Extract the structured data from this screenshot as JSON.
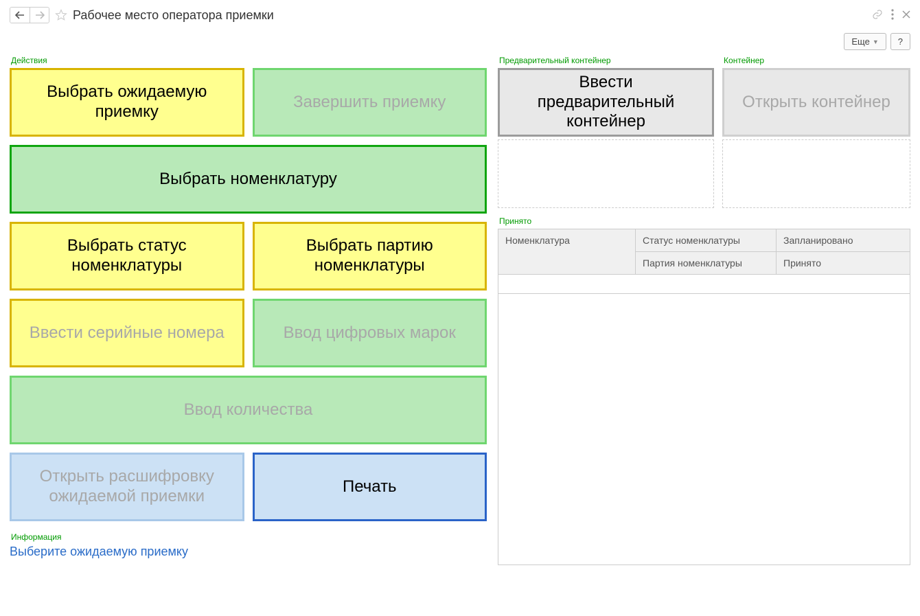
{
  "title": "Рабочее место оператора приемки",
  "toolbar": {
    "more": "Еще",
    "help": "?"
  },
  "groups": {
    "actions": "Действия",
    "precontainer": "Предварительный контейнер",
    "container": "Контейнер",
    "accepted": "Принято",
    "info": "Информация"
  },
  "buttons": {
    "select_expected": "Выбрать ожидаемую приемку",
    "finish_receipt": "Завершить приемку",
    "select_nomenclature": "Выбрать номенклатуру",
    "select_status": "Выбрать статус номенклатуры",
    "select_batch": "Выбрать партию номенклатуры",
    "enter_serials": "Ввести серийные номера",
    "enter_marks": "Ввод цифровых марок",
    "enter_quantity": "Ввод количества",
    "open_breakdown": "Открыть расшифровку ожидаемой приемки",
    "print": "Печать",
    "enter_precontainer": "Ввести предварительный контейнер",
    "open_container": "Открыть контейнер"
  },
  "table": {
    "nomenclature": "Номенклатура",
    "status": "Статус номенклатуры",
    "batch": "Партия номенклатуры",
    "planned": "Запланировано",
    "accepted": "Принято"
  },
  "info_text": "Выберите ожидаемую приемку"
}
